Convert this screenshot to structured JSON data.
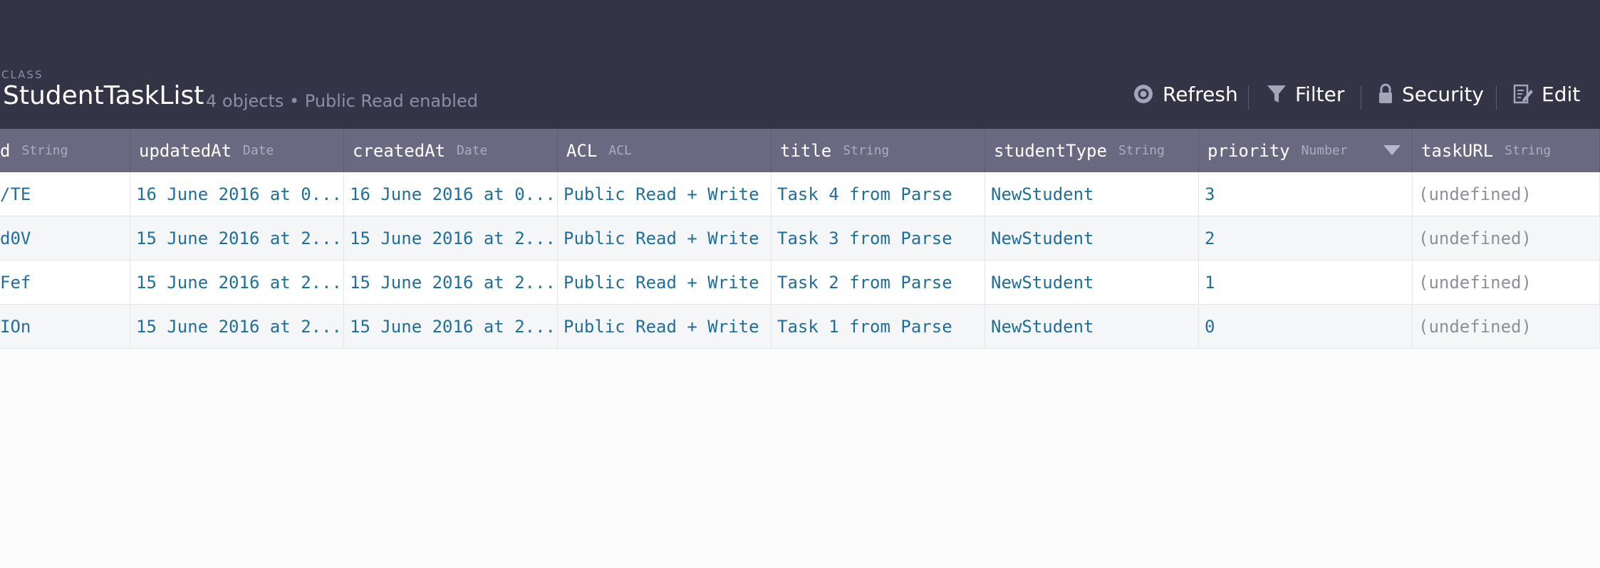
{
  "header": {
    "class_label": "CLASS",
    "class_name": "StudentTaskList",
    "subtitle": "4 objects • Public Read enabled"
  },
  "toolbar": {
    "refresh_label": "Refresh",
    "filter_label": "Filter",
    "security_label": "Security",
    "edit_label": "Edit"
  },
  "columns": [
    {
      "name": "d",
      "type": "String"
    },
    {
      "name": "updatedAt",
      "type": "Date"
    },
    {
      "name": "createdAt",
      "type": "Date"
    },
    {
      "name": "ACL",
      "type": "ACL"
    },
    {
      "name": "title",
      "type": "String"
    },
    {
      "name": "studentType",
      "type": "String"
    },
    {
      "name": "priority",
      "type": "Number"
    },
    {
      "name": "taskURL",
      "type": "String"
    }
  ],
  "rows": [
    [
      "/TE",
      "16 June 2016 at 0...",
      "16 June 2016 at 0...",
      "Public Read + Write",
      "Task 4 from Parse",
      "NewStudent",
      "3",
      "(undefined)"
    ],
    [
      "d0V",
      "15 June 2016 at 2...",
      "15 June 2016 at 2...",
      "Public Read + Write",
      "Task 3 from Parse",
      "NewStudent",
      "2",
      "(undefined)"
    ],
    [
      "Fef",
      "15 June 2016 at 2...",
      "15 June 2016 at 2...",
      "Public Read + Write",
      "Task 2 from Parse",
      "NewStudent",
      "1",
      "(undefined)"
    ],
    [
      "IOn",
      "15 June 2016 at 2...",
      "15 June 2016 at 2...",
      "Public Read + Write",
      "Task 1 from Parse",
      "NewStudent",
      "0",
      "(undefined)"
    ]
  ],
  "icons": {
    "refresh": "refresh-icon",
    "filter": "filter-icon",
    "security": "lock-icon",
    "edit": "edit-icon",
    "sort": "sort-down-icon"
  },
  "colors": {
    "header_bg": "#353446",
    "table_head_bg": "#6b6981",
    "link_text": "#1f6f9a",
    "undefined_text": "#8d8f99"
  }
}
